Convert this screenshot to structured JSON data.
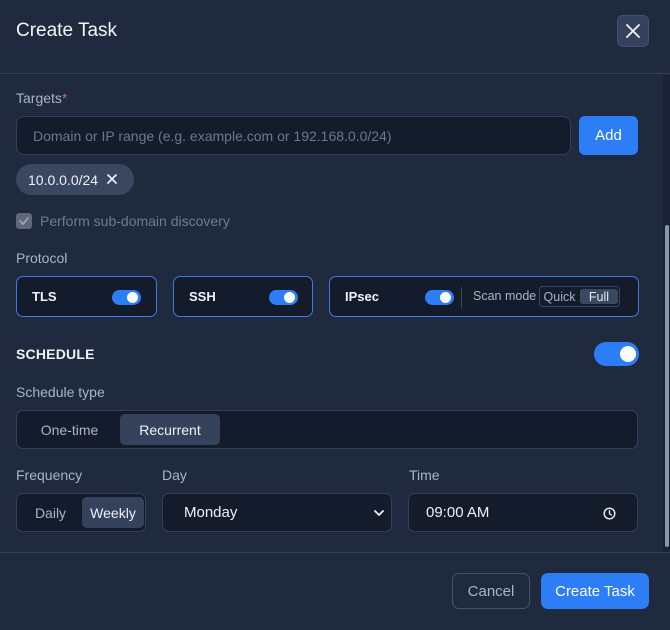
{
  "dialog": {
    "title": "Create Task"
  },
  "targets": {
    "label": "Targets",
    "required_mark": "*",
    "placeholder": "Domain or IP range (e.g. example.com or 192.168.0.0/24)",
    "add_label": "Add",
    "chips": [
      "10.0.0.0/24"
    ],
    "subdomain_discovery_label": "Perform sub-domain discovery",
    "subdomain_discovery_checked": true,
    "subdomain_discovery_disabled": true
  },
  "protocol": {
    "label": "Protocol",
    "items": [
      {
        "name": "TLS",
        "enabled": true
      },
      {
        "name": "SSH",
        "enabled": true
      },
      {
        "name": "IPsec",
        "enabled": true
      }
    ],
    "scan_mode_label": "Scan mode",
    "scan_mode_options": [
      "Quick",
      "Full"
    ],
    "scan_mode_selected": "Full"
  },
  "schedule": {
    "section_title": "SCHEDULE",
    "enabled": true,
    "type_label": "Schedule type",
    "type_options": [
      "One-time",
      "Recurrent"
    ],
    "type_selected": "Recurrent",
    "frequency_label": "Frequency",
    "frequency_options": [
      "Daily",
      "Weekly"
    ],
    "frequency_selected": "Weekly",
    "day_label": "Day",
    "day_value": "Monday",
    "time_label": "Time",
    "time_value": "09:00 AM"
  },
  "footer": {
    "cancel_label": "Cancel",
    "submit_label": "Create Task"
  },
  "colors": {
    "background": "#1f2a3e",
    "accent": "#2c7df6",
    "input_bg": "#141c2b",
    "border": "#33405a"
  }
}
